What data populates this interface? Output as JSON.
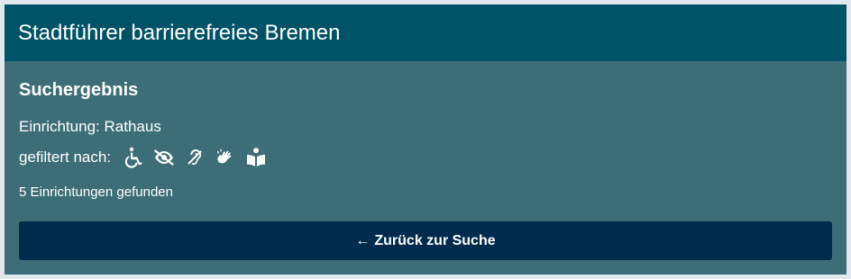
{
  "header": {
    "title": "Stadtführer barrierefreies Bremen"
  },
  "main": {
    "heading": "Suchergebnis",
    "facility": "Einrichtung: Rathaus",
    "filter_label": "gefiltert nach:",
    "filter_icons": [
      "wheelchair-icon",
      "low-vision-icon",
      "hearing-impaired-icon",
      "sign-language-icon",
      "easy-reading-icon"
    ],
    "result_count": "5 Einrichtungen gefunden",
    "back_button": {
      "arrow": "←",
      "label": "Zurück zur Suche"
    }
  },
  "colors": {
    "header_bg": "#005266",
    "panel_bg": "#3d6e78",
    "button_bg": "#002b4c",
    "page_bg": "#dfe9ee"
  }
}
